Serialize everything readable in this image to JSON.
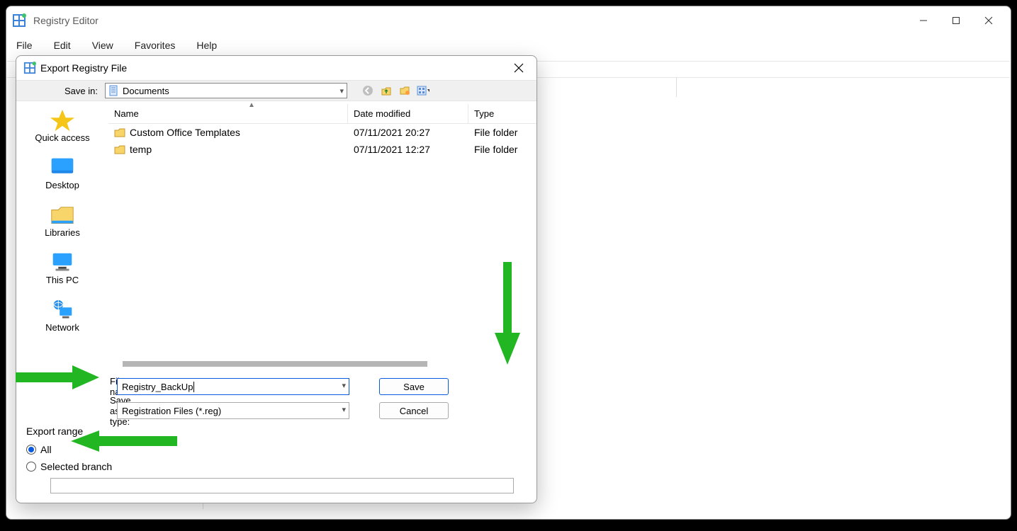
{
  "main_window": {
    "title": "Registry Editor",
    "menu": {
      "file": "File",
      "edit": "Edit",
      "view": "View",
      "favorites": "Favorites",
      "help": "Help"
    }
  },
  "dialog": {
    "title": "Export Registry File",
    "save_in": {
      "label": "Save in:",
      "value": "Documents"
    },
    "columns": {
      "name": "Name",
      "date": "Date modified",
      "type": "Type"
    },
    "rows": [
      {
        "name": "Custom Office Templates",
        "date": "07/11/2021 20:27",
        "type": "File folder"
      },
      {
        "name": "temp",
        "date": "07/11/2021 12:27",
        "type": "File folder"
      }
    ],
    "places": {
      "quick_access": "Quick access",
      "desktop": "Desktop",
      "libraries": "Libraries",
      "this_pc": "This PC",
      "network": "Network"
    },
    "file_name": {
      "label": "File name:",
      "value": "Registry_BackUp"
    },
    "save_as_type": {
      "label": "Save as type:",
      "value": "Registration Files (*.reg)"
    },
    "buttons": {
      "save": "Save",
      "cancel": "Cancel"
    },
    "export_range": {
      "legend": "Export range",
      "all": "All",
      "selected_branch": "Selected branch"
    }
  }
}
